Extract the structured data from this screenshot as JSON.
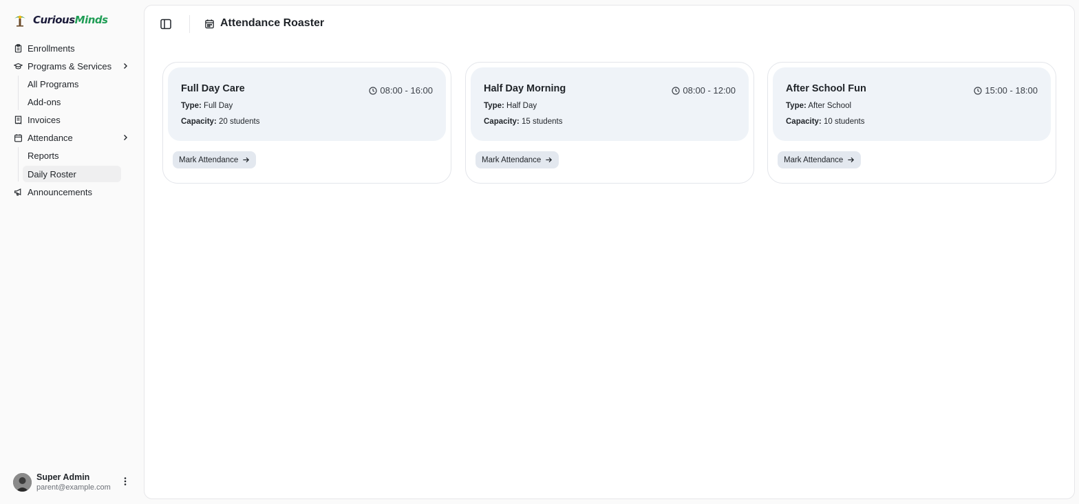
{
  "brand": {
    "part1": "Curious",
    "part2": "Minds"
  },
  "sidebar": {
    "items": [
      {
        "label": "Enrollments",
        "icon": "clipboard-icon"
      },
      {
        "label": "Programs & Services",
        "icon": "graduation-cap-icon",
        "expanded": true
      },
      {
        "label": "Invoices",
        "icon": "receipt-icon"
      },
      {
        "label": "Attendance",
        "icon": "calendar-icon",
        "expanded": true
      },
      {
        "label": "Announcements",
        "icon": "megaphone-icon"
      }
    ],
    "programs_sub": [
      "All Programs",
      "Add-ons"
    ],
    "attendance_sub": [
      "Reports",
      "Daily Roster"
    ],
    "active_sub": "Daily Roster"
  },
  "user": {
    "name": "Super Admin",
    "email": "parent@example.com"
  },
  "header": {
    "title": "Attendance Roaster"
  },
  "cards": [
    {
      "title": "Full Day Care",
      "time": "08:00 - 16:00",
      "type_label": "Type:",
      "type": "Full Day",
      "capacity_label": "Capacity:",
      "capacity": "20 students",
      "button": "Mark Attendance"
    },
    {
      "title": "Half Day Morning",
      "time": "08:00 - 12:00",
      "type_label": "Type:",
      "type": "Half Day",
      "capacity_label": "Capacity:",
      "capacity": "15 students",
      "button": "Mark Attendance"
    },
    {
      "title": "After School Fun",
      "time": "15:00 - 18:00",
      "type_label": "Type:",
      "type": "After School",
      "capacity_label": "Capacity:",
      "capacity": "10 students",
      "button": "Mark Attendance"
    }
  ],
  "colors": {
    "brand_dark": "#1b1b3a",
    "brand_green": "#1f9d55",
    "card_top_bg": "#eff3f8",
    "button_bg": "#e3e8ef"
  }
}
